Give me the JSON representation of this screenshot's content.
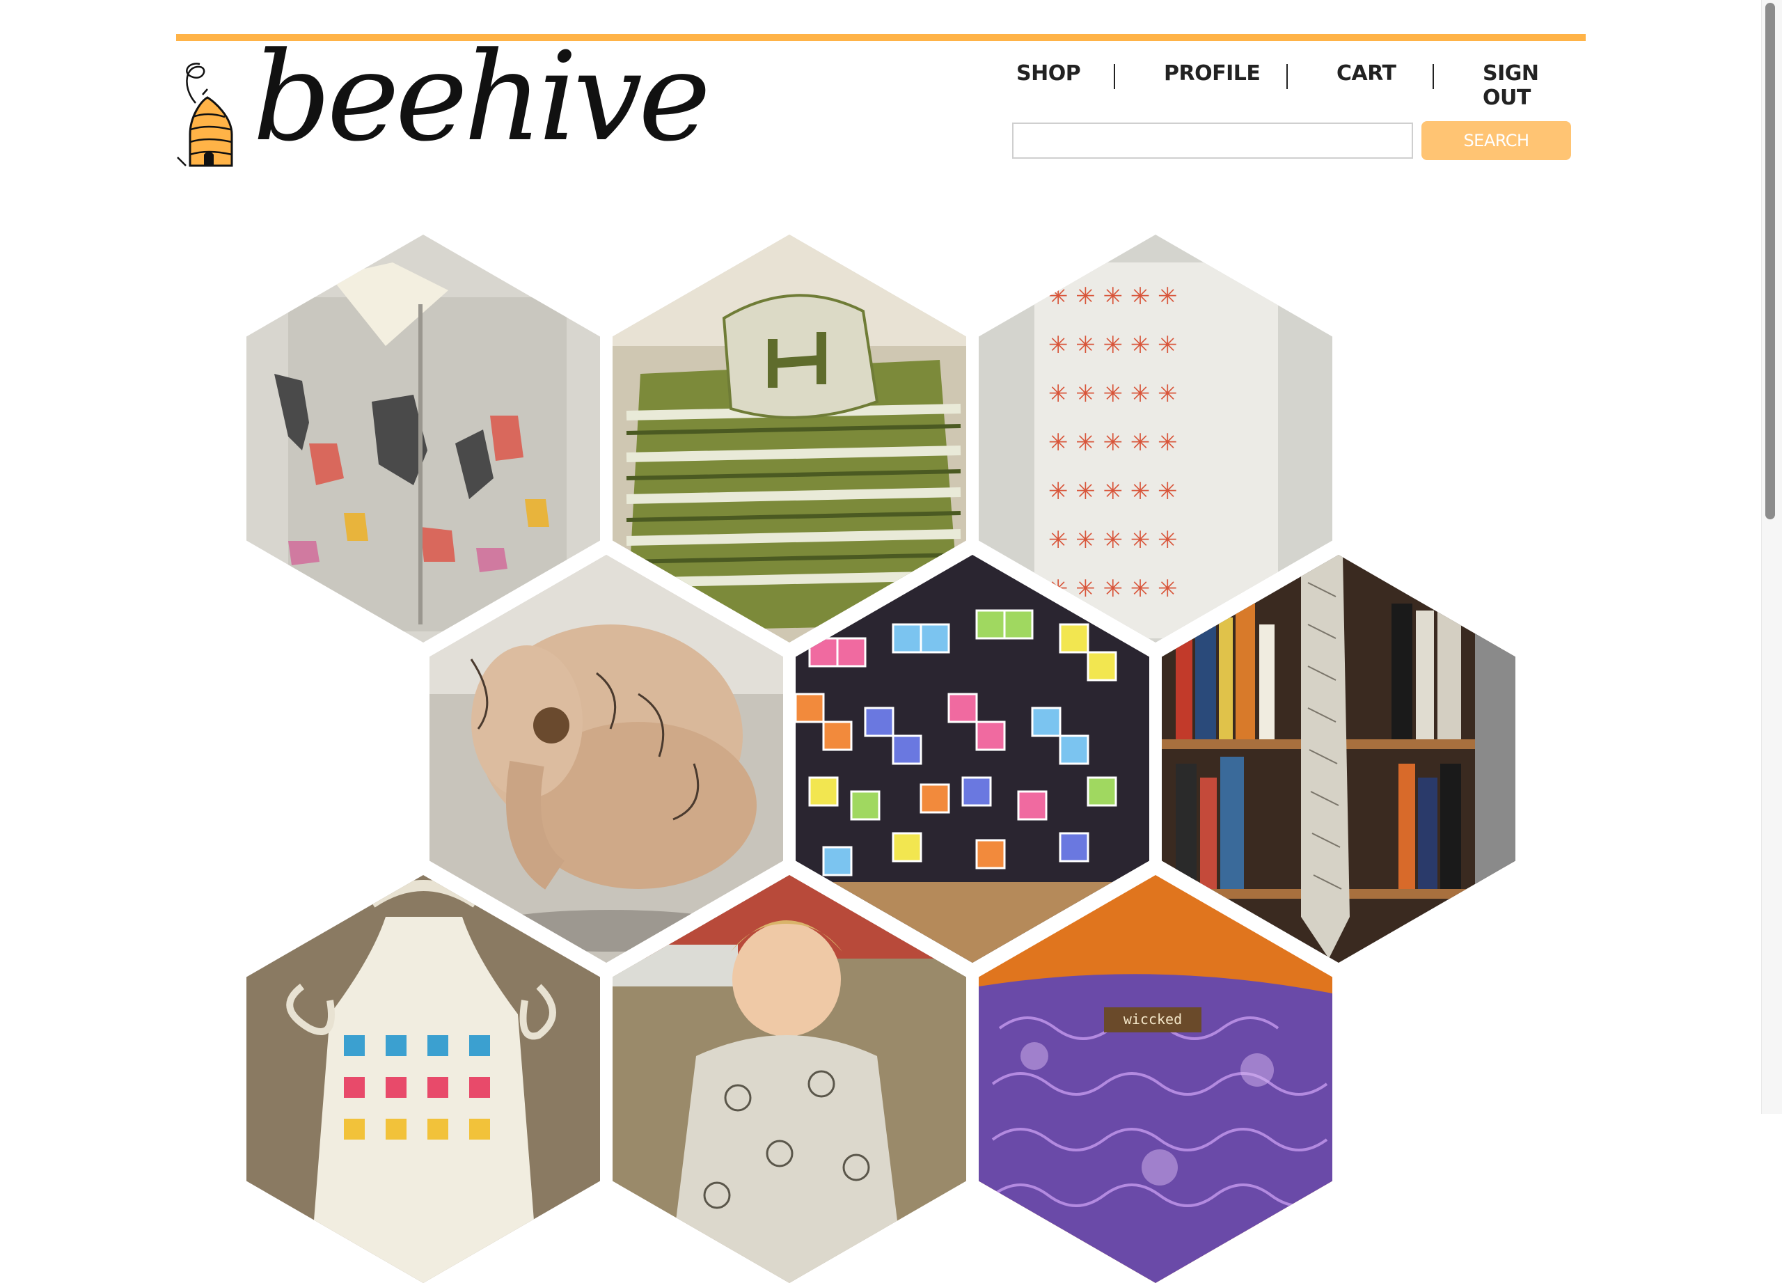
{
  "header": {
    "logo_text": "beehive",
    "nav": [
      {
        "label": "SHOP"
      },
      {
        "label": "PROFILE"
      },
      {
        "label": "CART"
      },
      {
        "label": "SIGN OUT"
      }
    ],
    "search": {
      "value": "",
      "placeholder": "",
      "button_label": "SEARCH"
    }
  },
  "gallery": {
    "tiles": [
      {
        "subject": "deer-print-fabric-book"
      },
      {
        "subject": "striped-armchair-with-pillow"
      },
      {
        "subject": "orange-star-print-fabric"
      },
      {
        "subject": "doodled-stuffed-elephant"
      },
      {
        "subject": "tetris-block-print-fabric"
      },
      {
        "subject": "printed-tie-on-bookshelf"
      },
      {
        "subject": "printed-apron"
      },
      {
        "subject": "toddler-in-printed-shirt"
      },
      {
        "subject": "purple-patterned-pillow"
      }
    ],
    "pillow_tag": "wiccked"
  },
  "colors": {
    "accent": "#ffb347",
    "button": "#ffc473",
    "text": "#222222"
  }
}
